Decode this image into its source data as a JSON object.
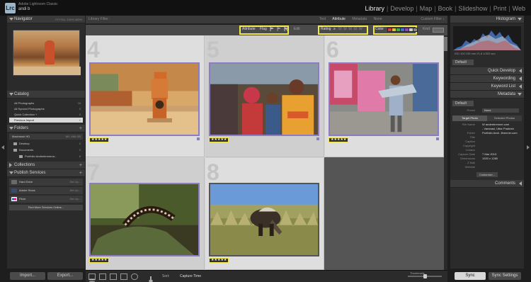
{
  "app": {
    "badge": "Lrc",
    "name": "Adobe Lightroom Classic",
    "user": "andi b"
  },
  "modules": [
    {
      "label": "Library",
      "active": true
    },
    {
      "label": "Develop",
      "active": false
    },
    {
      "label": "Map",
      "active": false
    },
    {
      "label": "Book",
      "active": false
    },
    {
      "label": "Slideshow",
      "active": false
    },
    {
      "label": "Print",
      "active": false
    },
    {
      "label": "Web",
      "active": false
    }
  ],
  "left_panel": {
    "navigator": {
      "title": "Navigator",
      "options": "FIT  FILL  100%  400%"
    },
    "catalog": {
      "title": "Catalog",
      "items": [
        {
          "label": "All Photographs",
          "count": "18"
        },
        {
          "label": "All Synced Photographs",
          "count": "0"
        },
        {
          "label": "Quick Collection +",
          "count": "0"
        },
        {
          "label": "Previous Import",
          "count": "8"
        }
      ]
    },
    "folders": {
      "title": "Folders",
      "drive": {
        "label": "Macintosh HD",
        "count": "88 / 466 GB"
      },
      "items": [
        {
          "label": "Desktop",
          "count": "0"
        },
        {
          "label": "Documents",
          "count": "0"
        },
        {
          "label": "Portfolio Andeebrenena...",
          "count": "8"
        }
      ]
    },
    "collections": {
      "title": "Collections"
    },
    "publish": {
      "title": "Publish Services",
      "items": [
        {
          "label": "Hard Drive",
          "setup": "Set Up..."
        },
        {
          "label": "Adobe Stock",
          "setup": "Set Up..."
        },
        {
          "label": "Flickr",
          "setup": "Set Up..."
        }
      ],
      "find_more": "Find More Services Online..."
    },
    "import_label": "Import...",
    "export_label": "Export..."
  },
  "filter_bar": {
    "title": "Library Filter :",
    "tabs": [
      {
        "label": "Text",
        "active": false
      },
      {
        "label": "Attribute",
        "active": true
      },
      {
        "label": "Metadata",
        "active": false
      },
      {
        "label": "None",
        "active": false
      }
    ],
    "preset": "Custom Filter ↕"
  },
  "attribute_bar": {
    "attribute_label": "Attribute",
    "flag_label": "Flag",
    "edit_label": "Edit",
    "rating_label": "Rating",
    "rating_op": "≥",
    "color_label": "Color",
    "kind_label": "Kind",
    "colors": [
      "#d04040",
      "#d9c440",
      "#4aa84a",
      "#4a6cc8",
      "#8a4ab8",
      "#cccccc",
      "#888888"
    ]
  },
  "grid": {
    "cells": [
      {
        "num": "4",
        "stars": "★★★★★"
      },
      {
        "num": "5",
        "stars": "★★★★★"
      },
      {
        "num": "6",
        "stars": "★★★★★"
      },
      {
        "num": "7",
        "stars": "★★★★★"
      },
      {
        "num": "8",
        "stars": "★★★★★"
      }
    ]
  },
  "toolbar": {
    "sort_label": "Sort:",
    "sort_value": "Capture Time",
    "thumbnails_label": "Thumbnails"
  },
  "right_panel": {
    "histogram": {
      "title": "Histogram",
      "info": "ISO 100   135 mm   f/1.8   1/320 sec"
    },
    "quick_develop": {
      "title": "Quick Develop",
      "preset": "Default"
    },
    "keywording": {
      "title": "Keywording"
    },
    "keyword_list": {
      "title": "Keyword List"
    },
    "metadata": {
      "title": "Metadata",
      "preset_label": "Preset",
      "preset_value": "Default",
      "preset_select": "None",
      "tabs": [
        "Target Photo",
        "Selected Photos"
      ],
      "rows": [
        {
          "k": "File Name",
          "v": "W andeebrenner.com"
        },
        {
          "k": "",
          "v": "- Varanasi, Uttar Pradesh"
        },
        {
          "k": "Folder",
          "v": "Portfolio Andi...Brenner.com"
        },
        {
          "k": "Title",
          "v": ""
        },
        {
          "k": "Caption",
          "v": ""
        },
        {
          "k": "Copyright",
          "v": ""
        },
        {
          "k": "Creator",
          "v": ""
        },
        {
          "k": "Capture Date",
          "v": "7 Mar 2013"
        },
        {
          "k": "Dimensions",
          "v": "1920 x 1280"
        },
        {
          "k": "Z Mail",
          "v": ""
        },
        {
          "k": "Website",
          "v": ""
        }
      ],
      "customize": "Customize..."
    },
    "comments": {
      "title": "Comments"
    },
    "sync_label": "Sync",
    "sync_settings_label": "Sync Settings"
  }
}
